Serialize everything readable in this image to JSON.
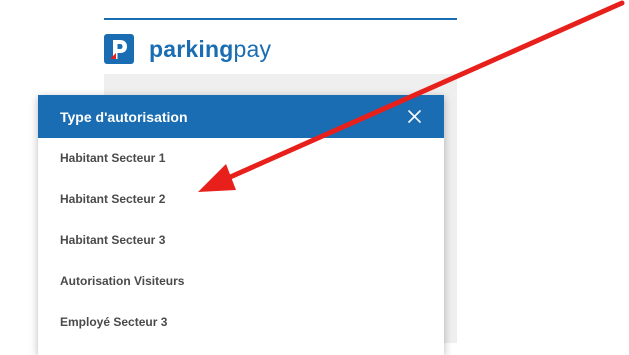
{
  "brand": {
    "name_bold": "parking",
    "name_light": "pay",
    "color": "#1a6db2"
  },
  "modal": {
    "title": "Type d'autorisation",
    "close_icon": "close-icon",
    "options": [
      {
        "label": "Habitant Secteur 1"
      },
      {
        "label": "Habitant Secteur 2"
      },
      {
        "label": "Habitant Secteur 3"
      },
      {
        "label": "Autorisation Visiteurs"
      },
      {
        "label": "Employé Secteur 3"
      }
    ]
  },
  "annotation": {
    "type": "arrow",
    "color": "#e8201c",
    "points_to": "Habitant Secteur 2"
  }
}
